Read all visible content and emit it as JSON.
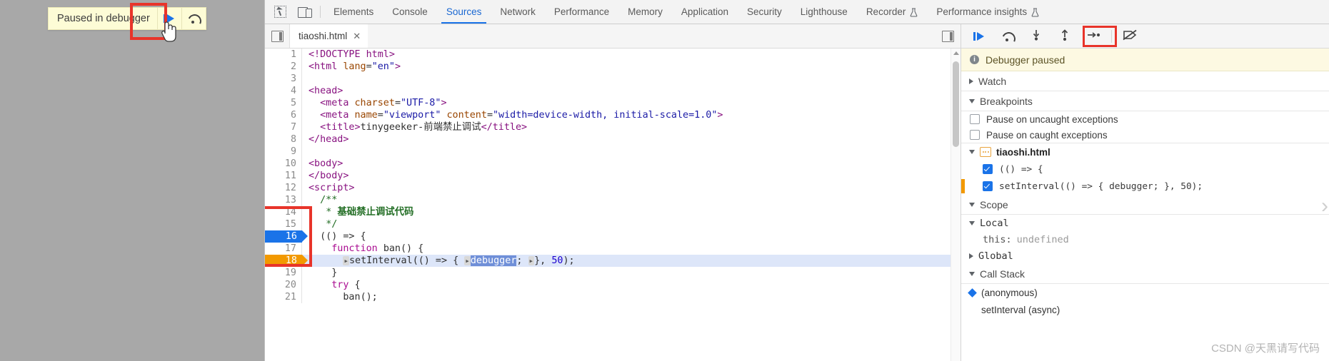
{
  "overlay": {
    "paused_text": "Paused in debugger",
    "resume_icon": "resume-script-icon",
    "step_over_icon": "step-over-icon",
    "cursor_icon": "hand-pointer-cursor"
  },
  "devtools": {
    "icons": {
      "inspect": "inspect-element-icon",
      "device": "device-toolbar-icon",
      "panel_toggle": "navigator-panel-toggle-icon",
      "sidebar_toggle": "debugger-sidebar-toggle-icon"
    },
    "tabs": [
      {
        "label": "Elements",
        "active": false
      },
      {
        "label": "Console",
        "active": false
      },
      {
        "label": "Sources",
        "active": true
      },
      {
        "label": "Network",
        "active": false
      },
      {
        "label": "Performance",
        "active": false
      },
      {
        "label": "Memory",
        "active": false
      },
      {
        "label": "Application",
        "active": false
      },
      {
        "label": "Security",
        "active": false
      },
      {
        "label": "Lighthouse",
        "active": false
      },
      {
        "label": "Recorder",
        "active": false,
        "badge": "experiment-flask-icon"
      },
      {
        "label": "Performance insights",
        "active": false,
        "badge": "experiment-flask-icon"
      }
    ],
    "file_tab": {
      "name": "tiaoshi.html",
      "close": "✕"
    }
  },
  "editor": {
    "lines": [
      {
        "n": "1",
        "bp": "",
        "html": "<span class='t-tag'>&lt;!DOCTYPE html&gt;</span>"
      },
      {
        "n": "2",
        "bp": "",
        "html": "<span class='t-tag'>&lt;html</span> <span class='t-attr'>lang</span>=<span class='t-str'>\"en\"</span><span class='t-tag'>&gt;</span>"
      },
      {
        "n": "3",
        "bp": "",
        "html": ""
      },
      {
        "n": "4",
        "bp": "",
        "html": "<span class='t-tag'>&lt;head&gt;</span>"
      },
      {
        "n": "5",
        "bp": "",
        "html": "  <span class='t-tag'>&lt;meta</span> <span class='t-attr'>charset</span>=<span class='t-str'>\"UTF-8\"</span><span class='t-tag'>&gt;</span>"
      },
      {
        "n": "6",
        "bp": "",
        "html": "  <span class='t-tag'>&lt;meta</span> <span class='t-attr'>name</span>=<span class='t-str'>\"viewport\"</span> <span class='t-attr'>content</span>=<span class='t-str'>\"width=device-width, initial-scale=1.0\"</span><span class='t-tag'>&gt;</span>"
      },
      {
        "n": "7",
        "bp": "",
        "html": "  <span class='t-tag'>&lt;title&gt;</span><span class='t-plain'>tinygeeker-前端禁止调试</span><span class='t-tag'>&lt;/title&gt;</span>"
      },
      {
        "n": "8",
        "bp": "",
        "html": "<span class='t-tag'>&lt;/head&gt;</span>"
      },
      {
        "n": "9",
        "bp": "",
        "html": ""
      },
      {
        "n": "10",
        "bp": "",
        "html": "<span class='t-tag'>&lt;body&gt;</span>"
      },
      {
        "n": "11",
        "bp": "",
        "html": "<span class='t-tag'>&lt;/body&gt;</span>"
      },
      {
        "n": "12",
        "bp": "",
        "html": "<span class='t-tag'>&lt;script&gt;</span>"
      },
      {
        "n": "13",
        "bp": "",
        "html": "  <span class='t-com2'>/**</span>"
      },
      {
        "n": "14",
        "bp": "",
        "html": "   <span class='t-com2'>*</span> <span class='t-com'>基础禁止调试代码</span>"
      },
      {
        "n": "15",
        "bp": "",
        "html": "   <span class='t-com2'>*/</span>"
      },
      {
        "n": "16",
        "bp": "blue",
        "html": "  <span class='t-plain'>((</span><span class='t-plain'>) =&gt; {</span>"
      },
      {
        "n": "17",
        "bp": "",
        "html": "    <span class='t-kw'>function</span> <span class='t-fn'>ban</span><span class='t-plain'>() {</span>"
      },
      {
        "n": "18",
        "bp": "orange",
        "paused": true,
        "html": "      <span class='fold'>&#9656;</span><span class='t-fn'>setInterval</span><span class='t-plain'>(() =&gt; { </span><span class='fold'>&#9656;</span><span class='sel'>debugger</span><span class='t-plain'>; </span><span class='fold'>&#9656;</span><span class='t-plain'>}, </span><span class='t-num'>50</span><span class='t-plain'>);</span>"
      },
      {
        "n": "19",
        "bp": "",
        "html": "    <span class='t-plain'>}</span>"
      },
      {
        "n": "20",
        "bp": "",
        "html": "    <span class='t-kw'>try</span> <span class='t-plain'>{</span>"
      },
      {
        "n": "21",
        "bp": "",
        "html": "      <span class='t-fn'>ban</span><span class='t-plain'>();</span>"
      }
    ]
  },
  "debugger_toolbar": {
    "buttons": [
      {
        "name": "resume-script-execution",
        "icon": "resume-icon"
      },
      {
        "name": "step-over-next-function-call",
        "icon": "step-over-icon"
      },
      {
        "name": "step-into-next-function-call",
        "icon": "step-into-icon"
      },
      {
        "name": "step-out-of-current-function",
        "icon": "step-out-icon"
      },
      {
        "name": "step",
        "icon": "step-icon"
      },
      {
        "name": "deactivate-breakpoints",
        "icon": "deactivate-breakpoints-icon",
        "highlighted": true
      }
    ]
  },
  "sidebar": {
    "paused_banner": "Debugger paused",
    "sections": {
      "watch": {
        "label": "Watch",
        "expanded": false
      },
      "breakpoints": {
        "label": "Breakpoints",
        "expanded": true,
        "options": [
          {
            "label": "Pause on uncaught exceptions",
            "checked": false
          },
          {
            "label": "Pause on caught exceptions",
            "checked": false
          }
        ],
        "file": "tiaoshi.html",
        "items": [
          {
            "label": "(() => {",
            "checked": true,
            "hit": false
          },
          {
            "label": "setInterval(() => { debugger; }, 50);",
            "checked": true,
            "hit": true
          }
        ]
      },
      "scope": {
        "label": "Scope",
        "expanded": true,
        "local": {
          "label": "Local",
          "expanded": true,
          "vars": [
            {
              "name": "this:",
              "value": "undefined"
            }
          ]
        },
        "global": {
          "label": "Global",
          "expanded": false
        }
      },
      "call_stack": {
        "label": "Call Stack",
        "expanded": true,
        "frames": [
          {
            "label": "(anonymous)",
            "selected": true
          },
          {
            "label": "setInterval (async)",
            "selected": false
          }
        ]
      }
    }
  },
  "watermark": "CSDN @天黑请写代码",
  "colors": {
    "accent": "#1a73e8",
    "annotation": "#e8342a",
    "breakpoint_hit": "#f29900",
    "banner_bg": "#fdf9e2"
  }
}
